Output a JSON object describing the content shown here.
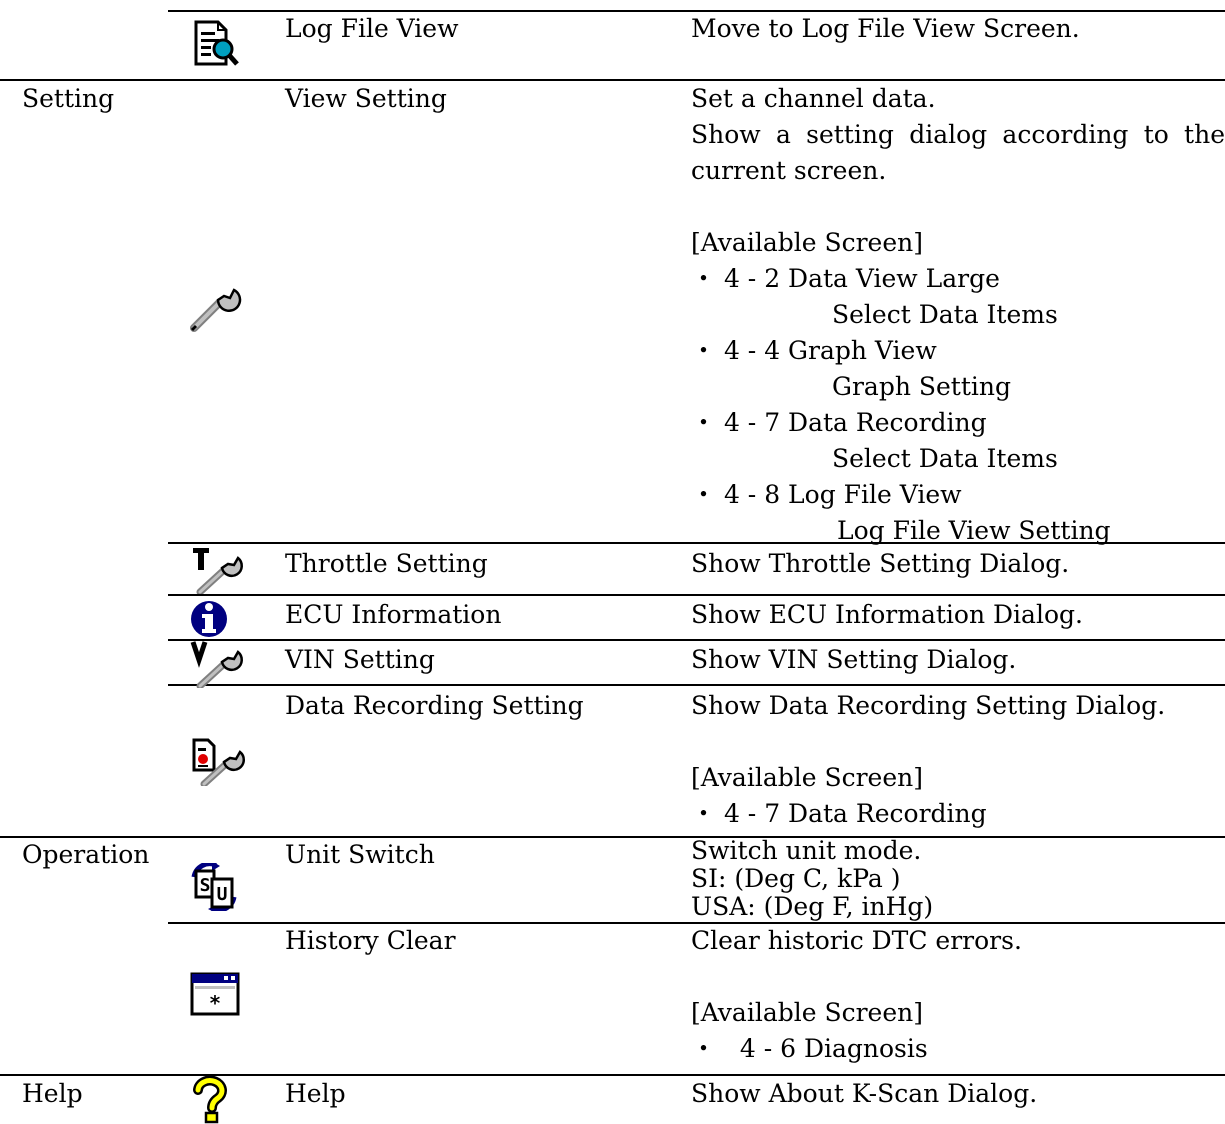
{
  "rows": {
    "log_file_view": {
      "name": "Log File View",
      "desc": [
        "Move to Log File View Screen."
      ],
      "icon": "log-file-view-icon"
    },
    "view_setting": {
      "category": "Setting",
      "name": "View Setting",
      "desc_main": [
        "Set a channel data.",
        "Show a setting dialog according to the",
        "current screen."
      ],
      "available_label": "[Available Screen]",
      "items": [
        {
          "bullet": "・ 4 - 2 Data View Large",
          "sub": "Select Data Items"
        },
        {
          "bullet": "・ 4 - 4 Graph View",
          "sub": "Graph Setting"
        },
        {
          "bullet": "・ 4 - 7 Data Recording",
          "sub": "Select Data Items"
        },
        {
          "bullet": "・ 4 - 8 Log File View",
          "sub": "Log File View Setting"
        }
      ],
      "icon": "wrench-icon"
    },
    "throttle_setting": {
      "name": "Throttle Setting",
      "desc": [
        "Show Throttle Setting Dialog."
      ],
      "icon": "throttle-setting-icon"
    },
    "ecu_information": {
      "name": "ECU Information",
      "desc": [
        "Show ECU Information Dialog."
      ],
      "icon": "info-icon"
    },
    "vin_setting": {
      "name": "VIN Setting",
      "desc": [
        "Show VIN Setting Dialog."
      ],
      "icon": "vin-setting-icon"
    },
    "data_recording_setting": {
      "name": "Data Recording Setting",
      "desc": [
        "Show Data Recording Setting Dialog."
      ],
      "available_label": "[Available Screen]",
      "items": [
        "・ 4 - 7 Data Recording"
      ],
      "icon": "data-recording-setting-icon"
    },
    "unit_switch": {
      "category": "Operation",
      "name": "Unit Switch",
      "desc": [
        "Switch unit mode.",
        "SI: (Deg C, kPa )",
        "USA: (Deg F, inHg)"
      ],
      "icon": "unit-switch-icon"
    },
    "history_clear": {
      "name": "History Clear",
      "desc": [
        "Clear historic DTC errors."
      ],
      "available_label": "[Available Screen]",
      "items": [
        "・   4 - 6 Diagnosis"
      ],
      "icon": "history-clear-icon"
    },
    "help": {
      "category": "Help",
      "name": "Help",
      "desc": [
        "Show About K-Scan Dialog."
      ],
      "icon": "help-icon"
    }
  },
  "colors": {
    "icon_navy": "#000080",
    "icon_gray": "#c0c0c0",
    "icon_yellow": "#ffff00",
    "icon_teal": "#00a0c0",
    "icon_red": "#e00000"
  }
}
